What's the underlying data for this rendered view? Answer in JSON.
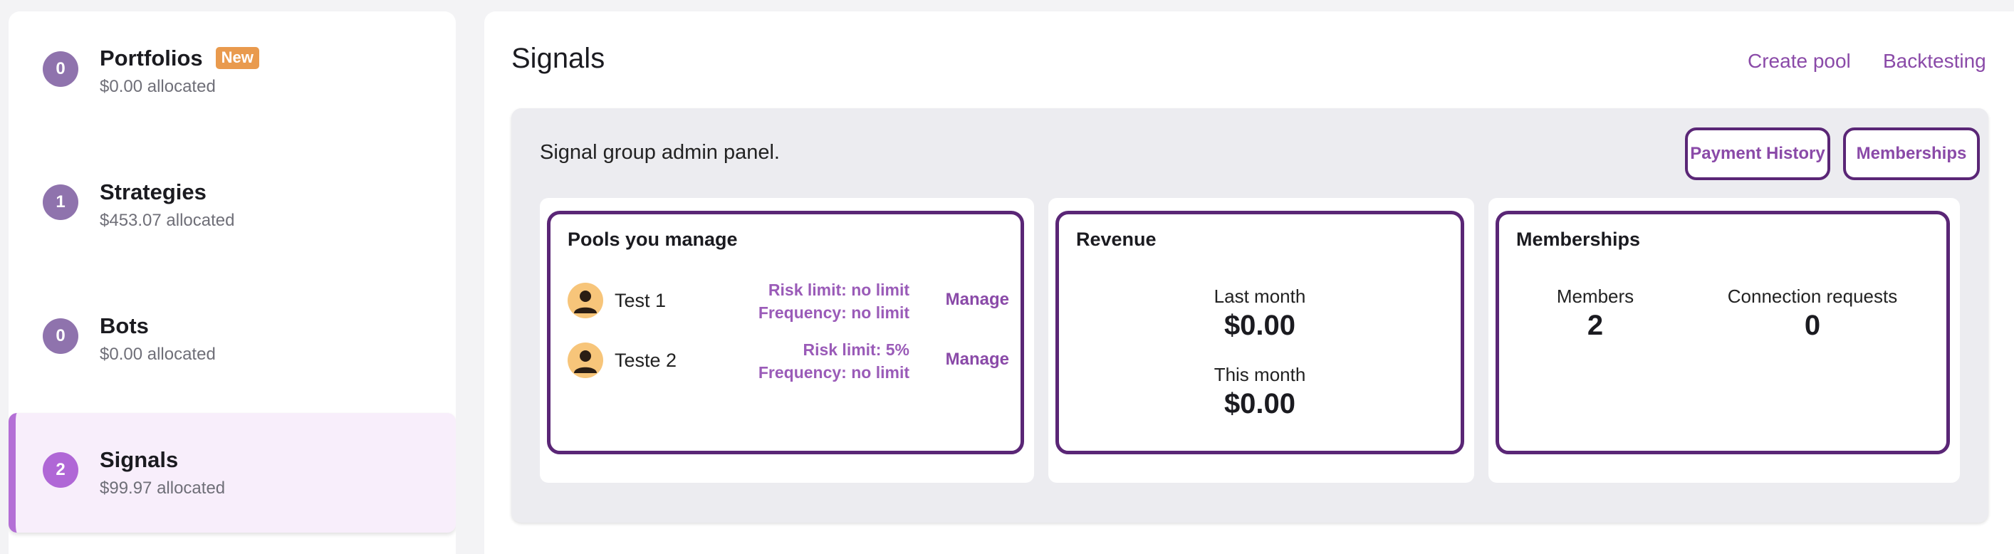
{
  "sidebar": {
    "items": [
      {
        "badge": "0",
        "title": "Portfolios",
        "tag": "New",
        "sub": "$0.00 allocated"
      },
      {
        "badge": "1",
        "title": "Strategies",
        "sub": "$453.07 allocated"
      },
      {
        "badge": "0",
        "title": "Bots",
        "sub": "$0.00 allocated"
      },
      {
        "badge": "2",
        "title": "Signals",
        "sub": "$99.97 allocated"
      }
    ]
  },
  "header": {
    "title": "Signals",
    "create_pool": "Create pool",
    "backtesting": "Backtesting"
  },
  "admin": {
    "text": "Signal group admin panel.",
    "payment_history": "Payment History",
    "memberships_button": "Memberships"
  },
  "pools": {
    "title": "Pools you manage",
    "rows": [
      {
        "name": "Test 1",
        "risk": "Risk limit: no limit",
        "frequency": "Frequency: no limit",
        "action": "Manage"
      },
      {
        "name": "Teste 2",
        "risk": "Risk limit: 5%",
        "frequency": "Frequency: no limit",
        "action": "Manage"
      }
    ]
  },
  "revenue": {
    "title": "Revenue",
    "last_month_label": "Last month",
    "last_month_value": "$0.00",
    "this_month_label": "This month",
    "this_month_value": "$0.00"
  },
  "memberships": {
    "title": "Memberships",
    "members_label": "Members",
    "members_value": "2",
    "requests_label": "Connection requests",
    "requests_value": "0"
  },
  "colors": {
    "accent": "#8a4aa8",
    "card_border": "#5a2676",
    "badge": "#8f73ad",
    "badge_active": "#b067d6",
    "new_tag": "#e99a4d",
    "avatar": "#f7c57a"
  },
  "icons": {
    "avatar": "user-avatar-icon"
  }
}
